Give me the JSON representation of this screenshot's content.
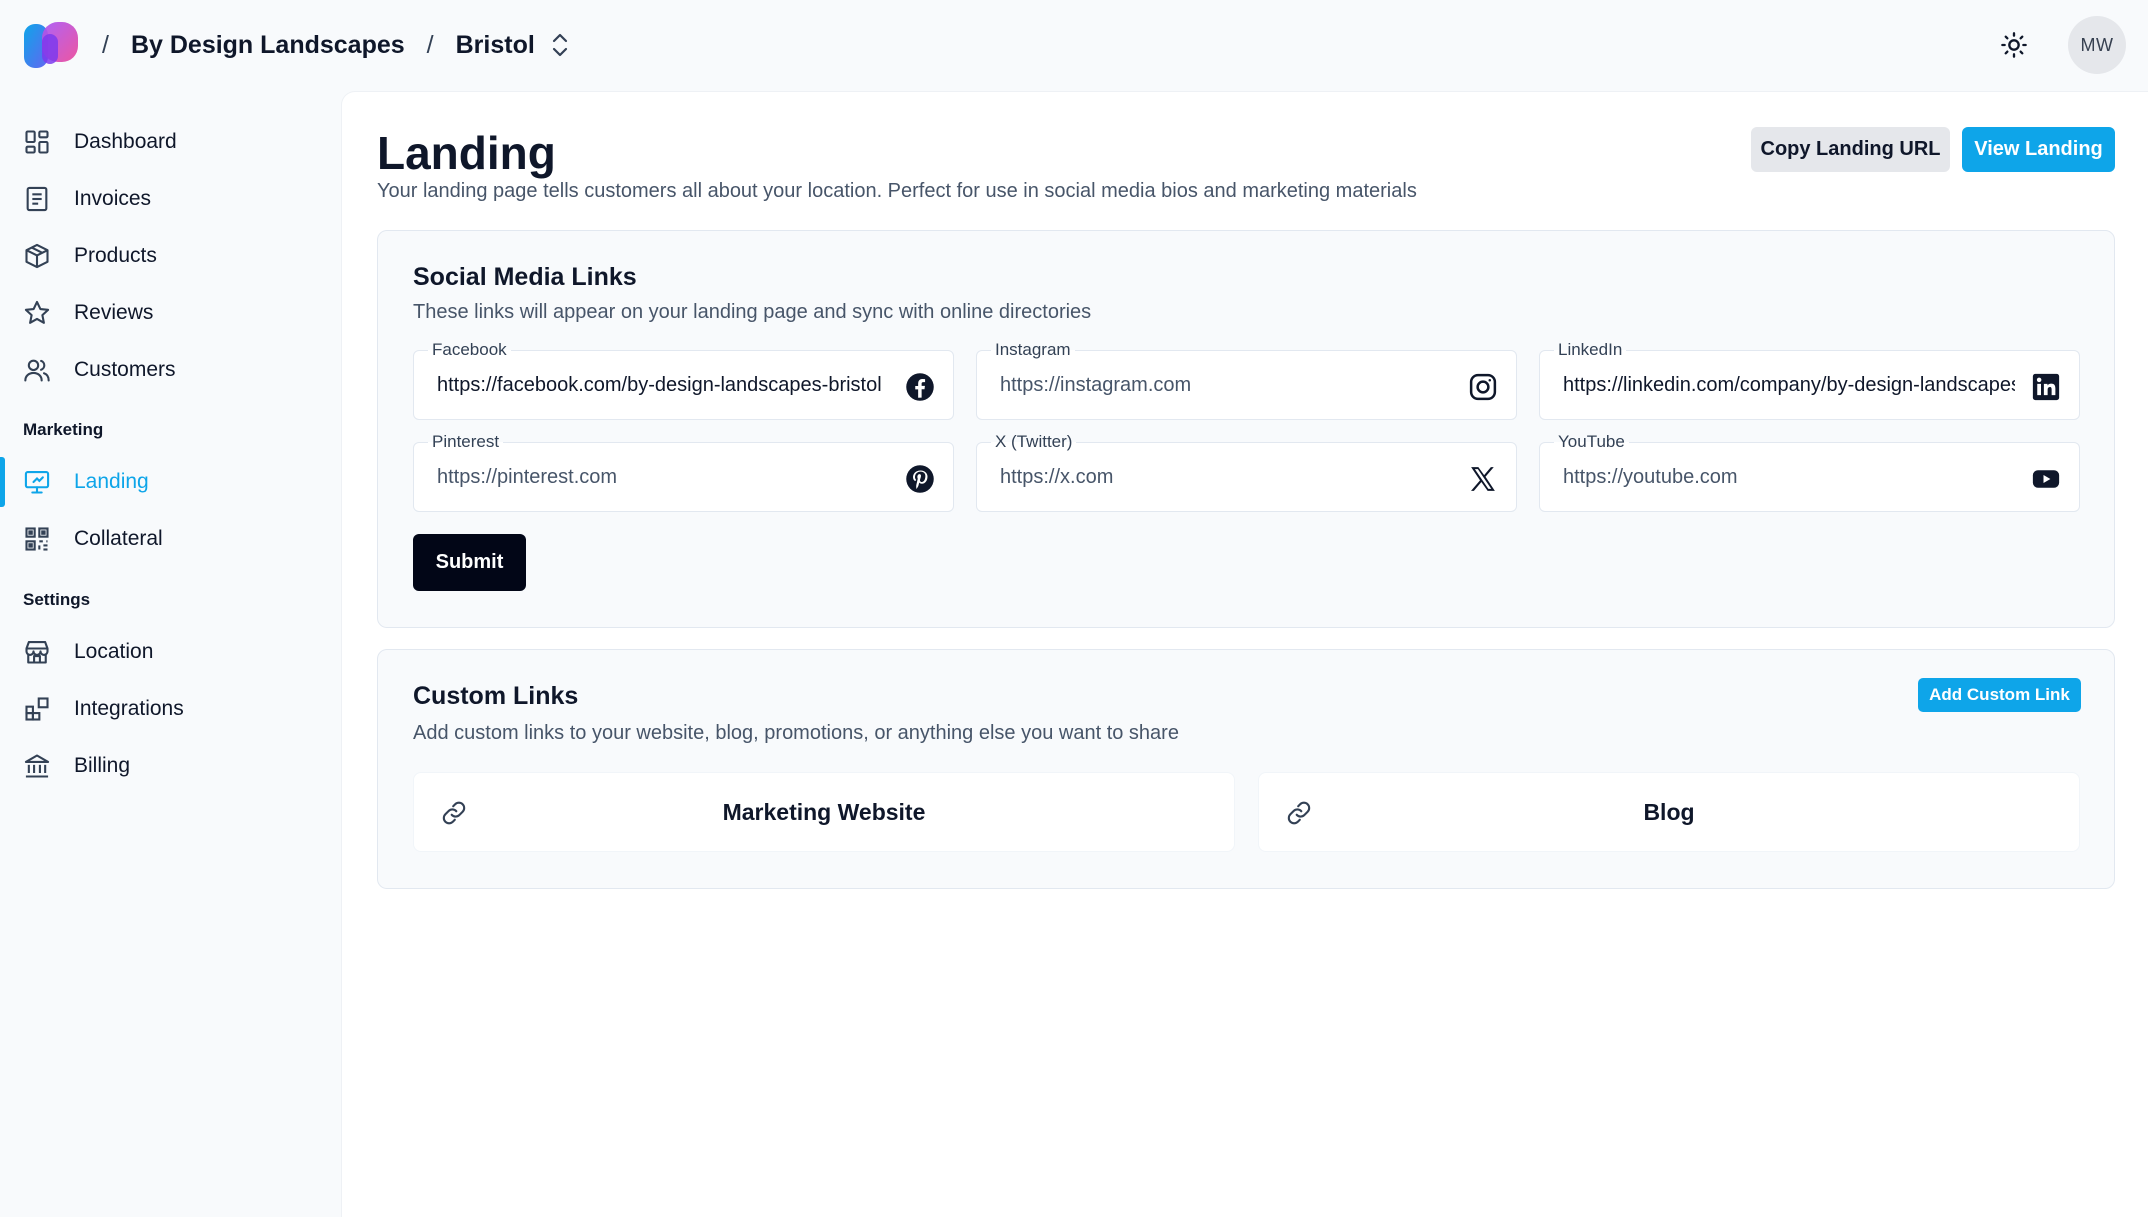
{
  "header": {
    "breadcrumbs": [
      "By Design Landscapes",
      "Bristol"
    ],
    "separator": "/",
    "avatar_initials": "MW",
    "icons": [
      "logo",
      "chevron-up-down-icon",
      "sun-icon"
    ]
  },
  "sidebar": {
    "items": [
      {
        "label": "Dashboard",
        "icon": "dashboard-icon"
      },
      {
        "label": "Invoices",
        "icon": "invoice-icon"
      },
      {
        "label": "Products",
        "icon": "package-icon"
      },
      {
        "label": "Reviews",
        "icon": "star-icon"
      },
      {
        "label": "Customers",
        "icon": "users-icon"
      }
    ],
    "marketing_heading": "Marketing",
    "marketing_items": [
      {
        "label": "Landing",
        "icon": "monitor-icon",
        "active": true
      },
      {
        "label": "Collateral",
        "icon": "qr-code-icon"
      }
    ],
    "settings_heading": "Settings",
    "settings_items": [
      {
        "label": "Location",
        "icon": "store-icon"
      },
      {
        "label": "Integrations",
        "icon": "integrations-icon"
      },
      {
        "label": "Billing",
        "icon": "bank-icon"
      }
    ]
  },
  "page": {
    "title": "Landing",
    "subtitle": "Your landing page tells customers all about your location. Perfect for use in social media bios and marketing materials",
    "copy_button": "Copy Landing URL",
    "view_button": "View Landing"
  },
  "social": {
    "title": "Social Media Links",
    "description": "These links will appear on your landing page and sync with online directories",
    "fields": [
      {
        "label": "Facebook",
        "value": "https://facebook.com/by-design-landscapes-bristol",
        "placeholder": "https://facebook.com",
        "icon": "facebook-icon"
      },
      {
        "label": "Instagram",
        "value": "",
        "placeholder": "https://instagram.com",
        "icon": "instagram-icon"
      },
      {
        "label": "LinkedIn",
        "value": "https://linkedin.com/company/by-design-landscapes",
        "placeholder": "https://linkedin.com",
        "icon": "linkedin-icon"
      },
      {
        "label": "Pinterest",
        "value": "",
        "placeholder": "https://pinterest.com",
        "icon": "pinterest-icon"
      },
      {
        "label": "X (Twitter)",
        "value": "",
        "placeholder": "https://x.com",
        "icon": "x-icon"
      },
      {
        "label": "YouTube",
        "value": "",
        "placeholder": "https://youtube.com",
        "icon": "youtube-icon"
      }
    ],
    "submit_label": "Submit"
  },
  "custom": {
    "title": "Custom Links",
    "description": "Add custom links to your website, blog, promotions, or anything else you want to share",
    "add_button": "Add Custom Link",
    "links": [
      {
        "label": "Marketing Website",
        "icon": "link-icon"
      },
      {
        "label": "Blog",
        "icon": "link-icon"
      }
    ]
  },
  "colors": {
    "accent": "#0ea5e9",
    "primary_dark": "#020617",
    "page_background": "#f8fafc"
  }
}
